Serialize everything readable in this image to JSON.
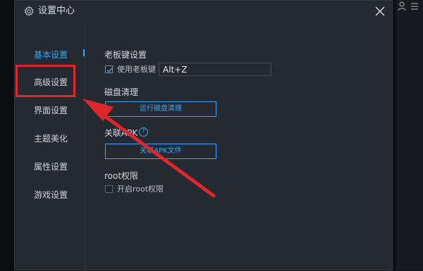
{
  "dialog": {
    "title": "设置中心",
    "icons": {
      "title": "gear-icon",
      "close": "close-icon"
    }
  },
  "background": {
    "icons": [
      "user-icon",
      "menu-icon"
    ]
  },
  "sidebar": {
    "items": [
      {
        "label": "基本设置",
        "active": true
      },
      {
        "label": "高级设置",
        "active": false,
        "highlighted": true
      },
      {
        "label": "界面设置",
        "active": false
      },
      {
        "label": "主题美化",
        "active": false
      },
      {
        "label": "属性设置",
        "active": false
      },
      {
        "label": "游戏设置",
        "active": false
      }
    ]
  },
  "boss_key": {
    "title": "老板键设置",
    "checkbox_label": "使用老板键",
    "checked": true,
    "hotkey_value": "Alt+Z"
  },
  "disk_cleanup": {
    "title": "磁盘清理",
    "button_label": "运行磁盘清理"
  },
  "associate_apk": {
    "title": "关联APK",
    "help_icon": "?",
    "button_label": "关联APK文件"
  },
  "root": {
    "title": "root权限",
    "checkbox_label": "开启root权限",
    "checked": false
  },
  "colors": {
    "accent": "#3aa4ec",
    "annotation": "#e0262d",
    "panel": "#252a32"
  }
}
